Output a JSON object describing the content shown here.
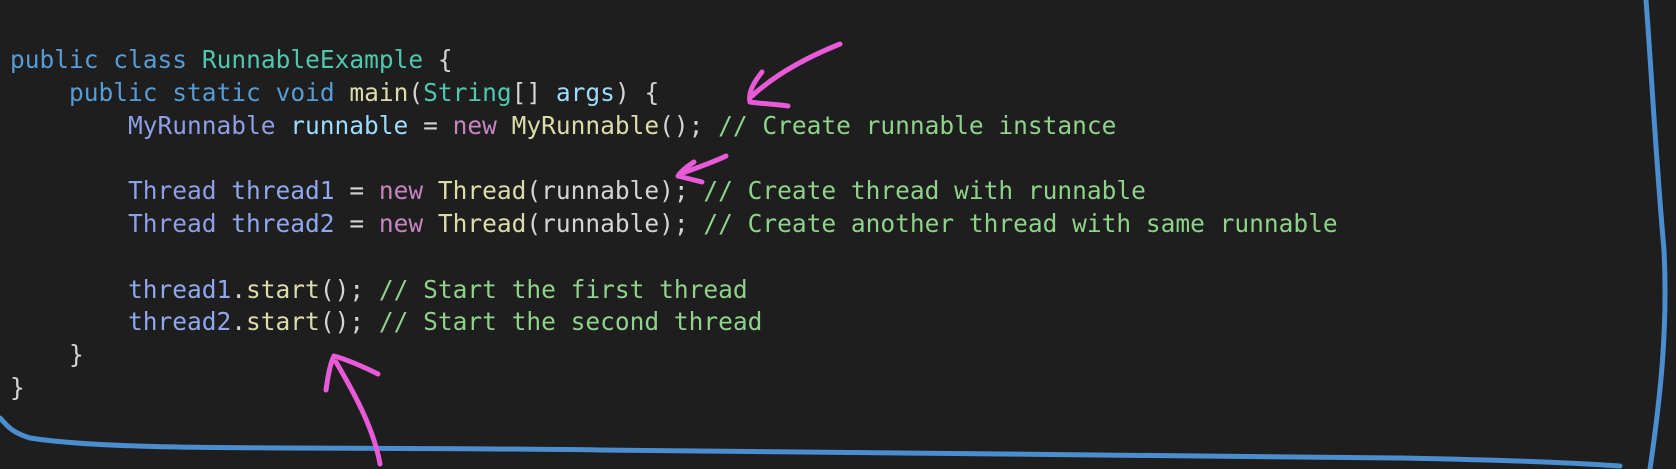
{
  "code": {
    "lines": [
      {
        "indent": "",
        "tokens": [
          {
            "t": "public",
            "c": "kw"
          },
          {
            "t": " ",
            "c": "pl"
          },
          {
            "t": "class",
            "c": "kw"
          },
          {
            "t": " ",
            "c": "pl"
          },
          {
            "t": "RunnableExample",
            "c": "cls"
          },
          {
            "t": " {",
            "c": "pl"
          }
        ]
      },
      {
        "indent": "    ",
        "tokens": [
          {
            "t": "public",
            "c": "kw"
          },
          {
            "t": " ",
            "c": "pl"
          },
          {
            "t": "static",
            "c": "kw"
          },
          {
            "t": " ",
            "c": "pl"
          },
          {
            "t": "void",
            "c": "kw"
          },
          {
            "t": " ",
            "c": "pl"
          },
          {
            "t": "main",
            "c": "fn"
          },
          {
            "t": "(",
            "c": "pl"
          },
          {
            "t": "String",
            "c": "cls"
          },
          {
            "t": "[] ",
            "c": "pl"
          },
          {
            "t": "args",
            "c": "var"
          },
          {
            "t": ") {",
            "c": "pl"
          }
        ]
      },
      {
        "indent": "        ",
        "tokens": [
          {
            "t": "MyRunnable",
            "c": "typ"
          },
          {
            "t": " ",
            "c": "pl"
          },
          {
            "t": "runnable",
            "c": "var"
          },
          {
            "t": " = ",
            "c": "pl"
          },
          {
            "t": "new",
            "c": "kw2"
          },
          {
            "t": " ",
            "c": "pl"
          },
          {
            "t": "MyRunnable",
            "c": "fn"
          },
          {
            "t": "(); ",
            "c": "pl"
          },
          {
            "t": "// Create runnable instance",
            "c": "cm2"
          }
        ]
      },
      {
        "indent": "",
        "tokens": []
      },
      {
        "indent": "        ",
        "tokens": [
          {
            "t": "Thread",
            "c": "typ"
          },
          {
            "t": " ",
            "c": "pl"
          },
          {
            "t": "thread1",
            "c": "v2"
          },
          {
            "t": " = ",
            "c": "pl"
          },
          {
            "t": "new",
            "c": "kw2"
          },
          {
            "t": " ",
            "c": "pl"
          },
          {
            "t": "Thread",
            "c": "fn"
          },
          {
            "t": "(runnable); ",
            "c": "pl"
          },
          {
            "t": "// Create thread with runnable",
            "c": "cm2"
          }
        ]
      },
      {
        "indent": "        ",
        "tokens": [
          {
            "t": "Thread",
            "c": "typ"
          },
          {
            "t": " ",
            "c": "pl"
          },
          {
            "t": "thread2",
            "c": "v2"
          },
          {
            "t": " = ",
            "c": "pl"
          },
          {
            "t": "new",
            "c": "kw2"
          },
          {
            "t": " ",
            "c": "pl"
          },
          {
            "t": "Thread",
            "c": "fn"
          },
          {
            "t": "(runnable); ",
            "c": "pl"
          },
          {
            "t": "// Create another thread with same runnable",
            "c": "cm2"
          }
        ]
      },
      {
        "indent": "",
        "tokens": []
      },
      {
        "indent": "        ",
        "tokens": [
          {
            "t": "thread1",
            "c": "v2"
          },
          {
            "t": ".",
            "c": "pl"
          },
          {
            "t": "start",
            "c": "fn"
          },
          {
            "t": "(); ",
            "c": "pl"
          },
          {
            "t": "// Start the first thread",
            "c": "cm2"
          }
        ]
      },
      {
        "indent": "        ",
        "tokens": [
          {
            "t": "thread2",
            "c": "v2"
          },
          {
            "t": ".",
            "c": "pl"
          },
          {
            "t": "start",
            "c": "fn"
          },
          {
            "t": "(); ",
            "c": "pl"
          },
          {
            "t": "// Start the second thread",
            "c": "cm2"
          }
        ]
      },
      {
        "indent": "    ",
        "tokens": [
          {
            "t": "}",
            "c": "pl"
          }
        ]
      },
      {
        "indent": "",
        "tokens": [
          {
            "t": "}",
            "c": "pl"
          }
        ]
      }
    ]
  },
  "annotations": {
    "arrow_color": "#e85ad8",
    "frame_color": "#4a8ed0",
    "arrows": [
      "arrow-to-main-args",
      "arrow-to-thread-runnable",
      "arrow-to-thread2-start"
    ]
  }
}
